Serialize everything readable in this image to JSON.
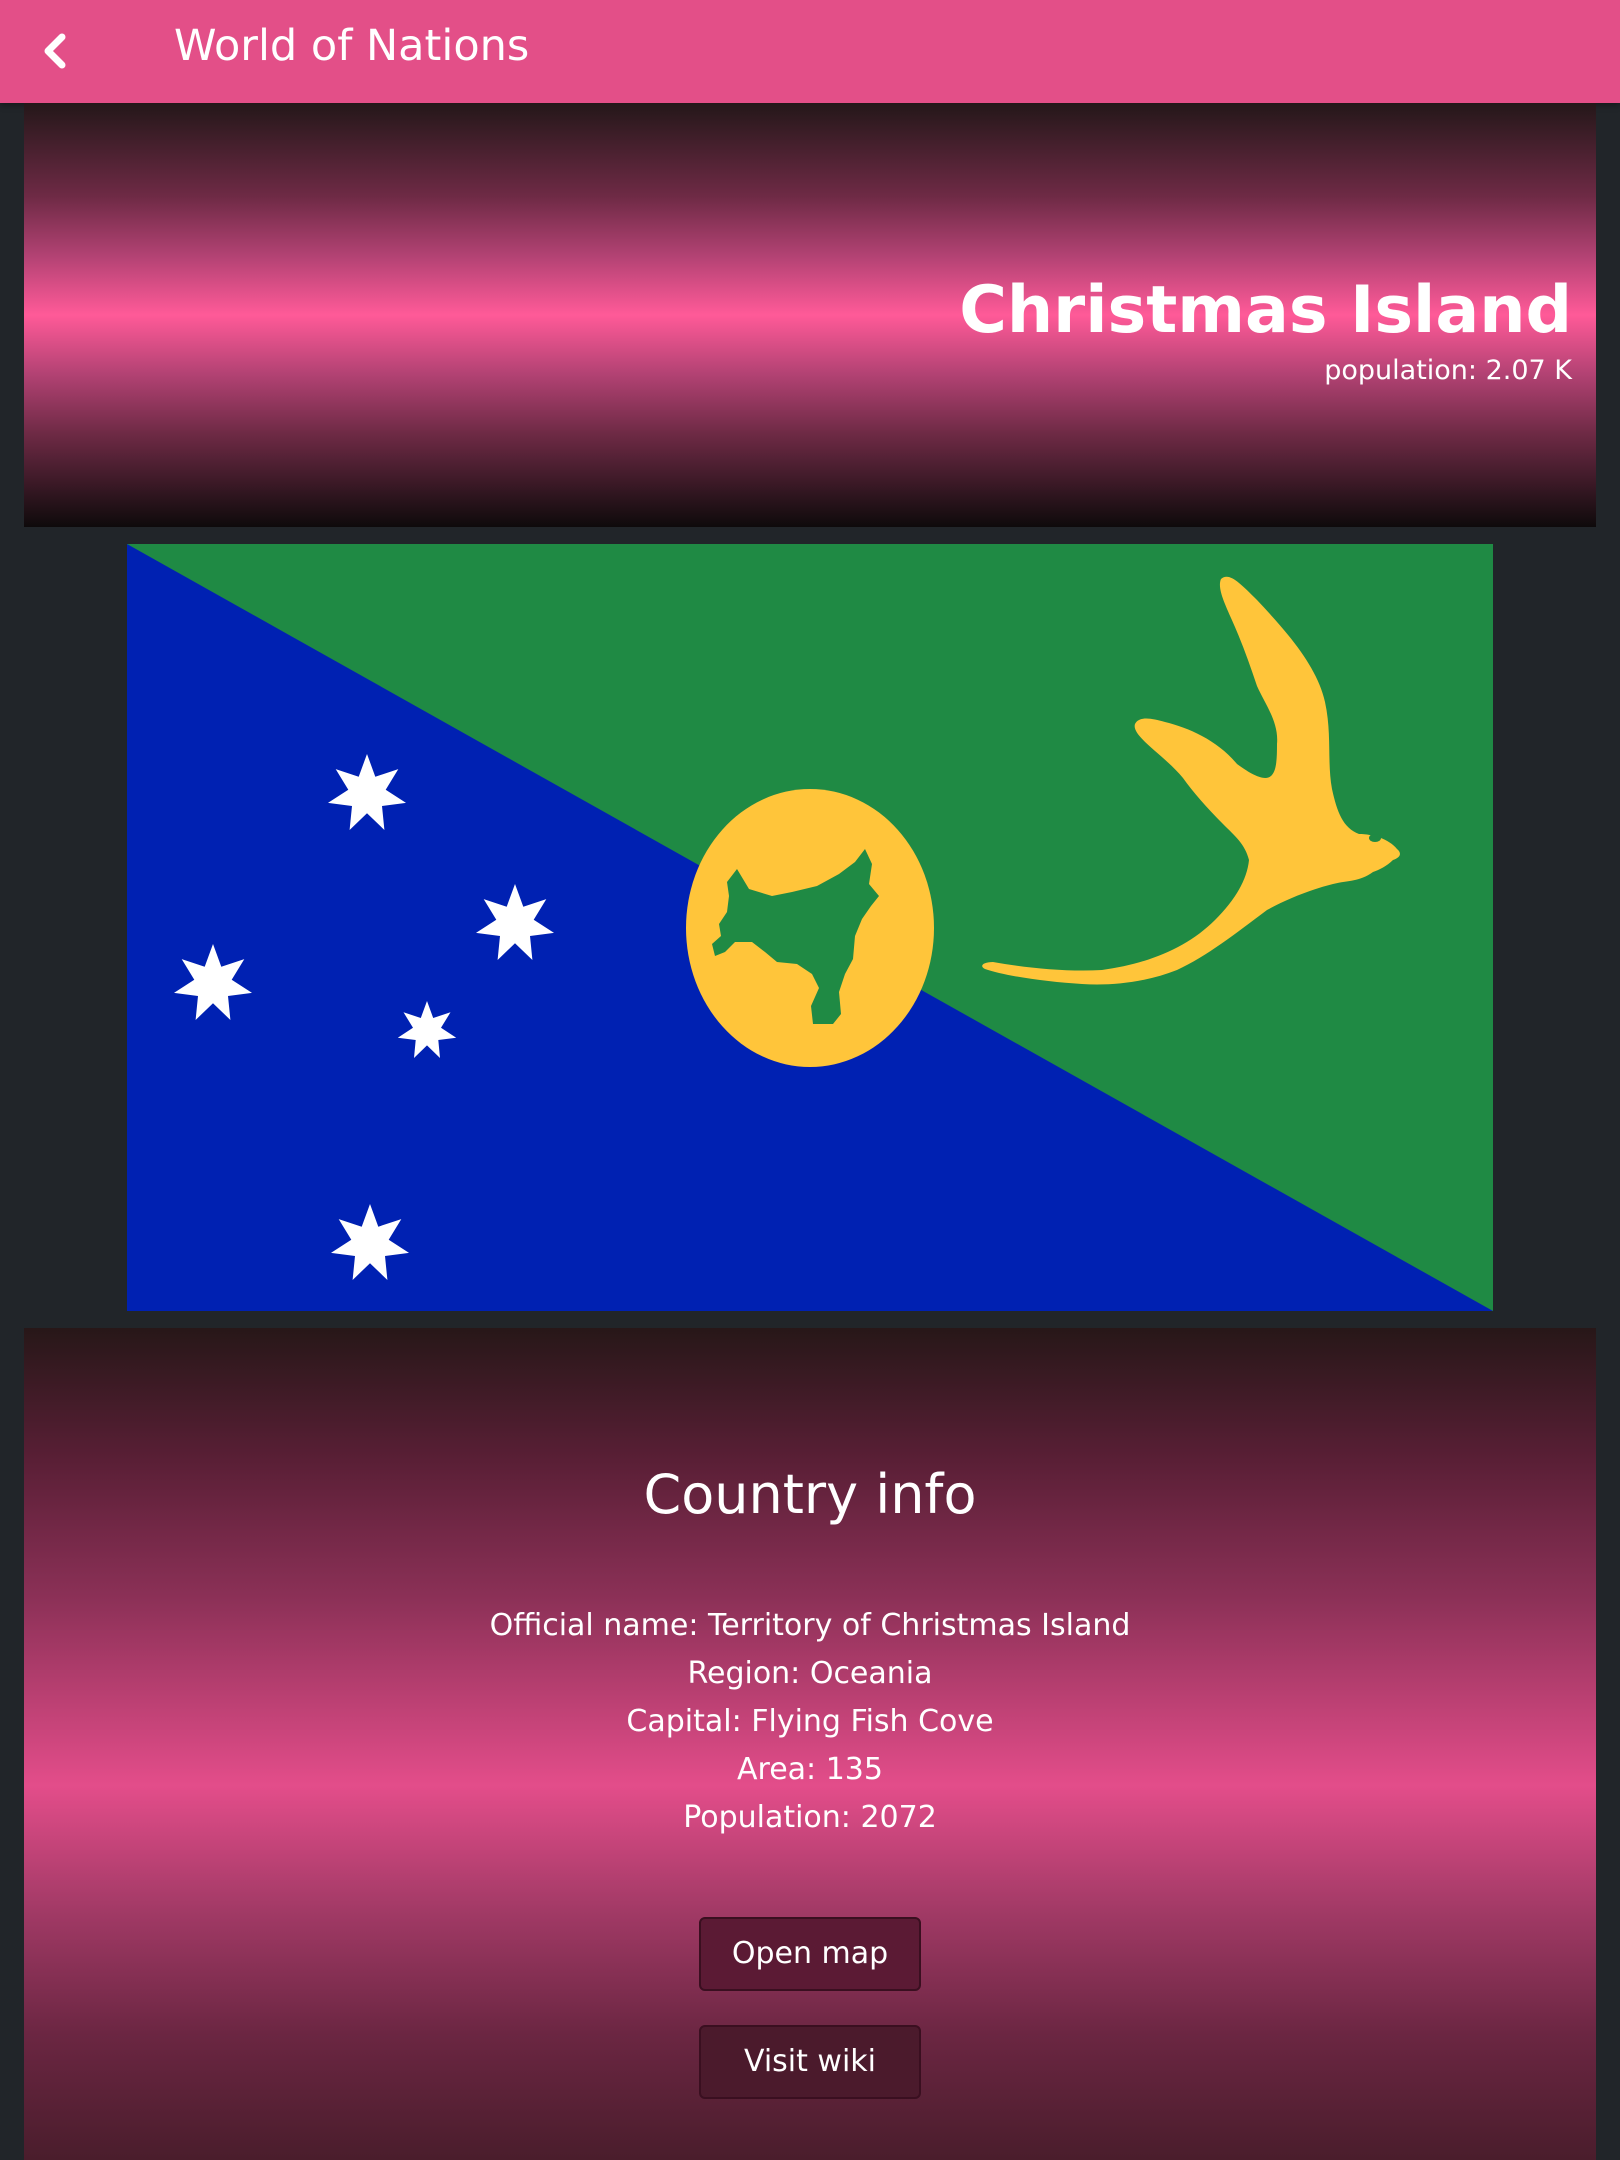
{
  "appbar": {
    "title": "World of Nations",
    "back_icon": "chevron-left-icon",
    "color": "#e34f88"
  },
  "hero": {
    "name": "Christmas Island",
    "population_label": "population: 2.07 K"
  },
  "flag": {
    "colors": {
      "blue": "#0021b2",
      "green": "#1f8a44",
      "gold": "#ffc53a",
      "white": "#ffffff"
    }
  },
  "info": {
    "title": "Country info",
    "official_name": "Official name: Territory of Christmas Island",
    "region": "Region: Oceania",
    "capital": "Capital: Flying Fish Cove",
    "area": "Area: 135",
    "population": "Population: 2072"
  },
  "buttons": {
    "open_map": "Open map",
    "visit_wiki": "Visit wiki"
  }
}
